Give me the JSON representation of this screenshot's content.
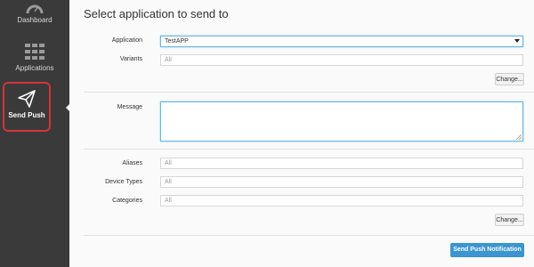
{
  "sidebar": {
    "items": [
      {
        "label": "Dashboard",
        "icon": "dashboard-icon"
      },
      {
        "label": "Applications",
        "icon": "grid-icon"
      },
      {
        "label": "Send Push",
        "icon": "paper-plane-icon",
        "active": true
      }
    ]
  },
  "main": {
    "title": "Select application to send to",
    "application": {
      "label": "Application",
      "value": "TestAPP"
    },
    "variants": {
      "label": "Variants",
      "placeholder": "All"
    },
    "change_label_1": "Change...",
    "message": {
      "label": "Message",
      "value": ""
    },
    "aliases": {
      "label": "Aliases",
      "placeholder": "All"
    },
    "device_types": {
      "label": "Device Types",
      "placeholder": "All"
    },
    "categories": {
      "label": "Categories",
      "placeholder": "All"
    },
    "change_label_2": "Change...",
    "submit_label": "Send Push Notification"
  },
  "colors": {
    "sidebar_bg": "#3a3a3a",
    "active_outline": "#d1343b",
    "primary_button": "#3a95d1",
    "focus_border": "#66b7e0"
  }
}
